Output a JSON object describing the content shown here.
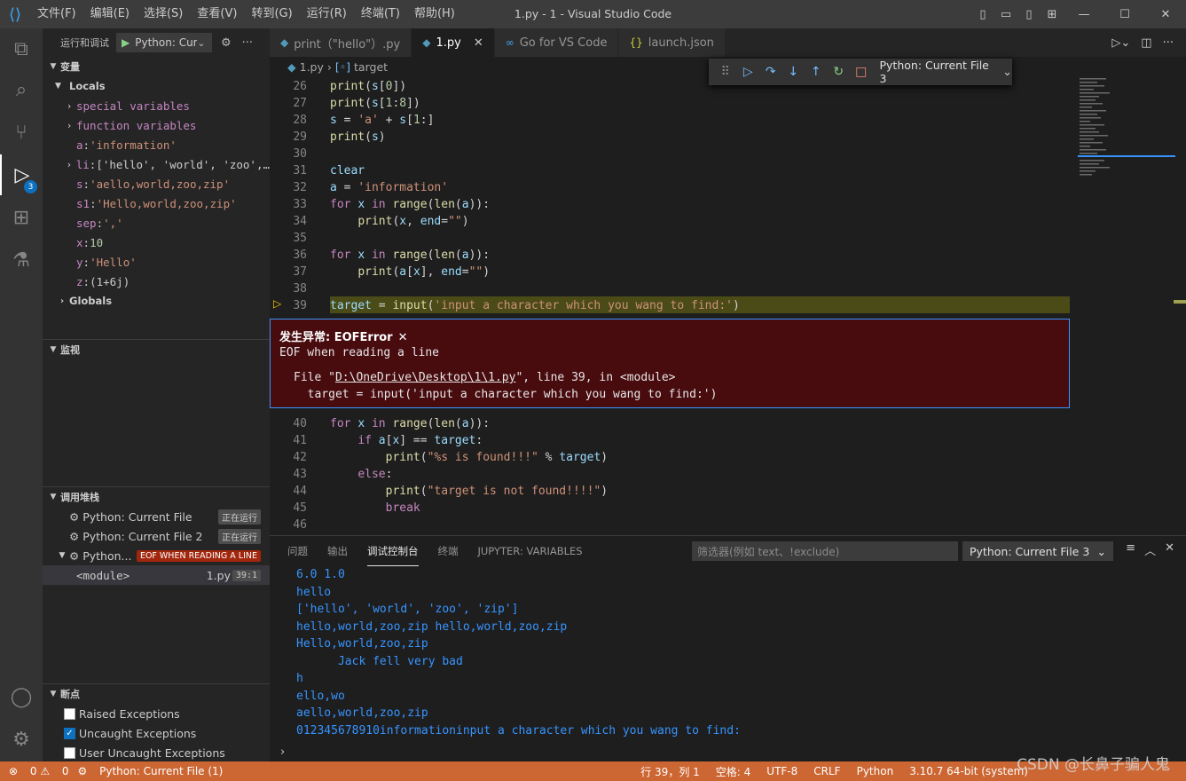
{
  "titlebar": {
    "menu": [
      "文件(F)",
      "编辑(E)",
      "选择(S)",
      "查看(V)",
      "转到(G)",
      "运行(R)",
      "终端(T)",
      "帮助(H)"
    ],
    "title": "1.py - 1 - Visual Studio Code"
  },
  "activity": {
    "debug_badge": "3"
  },
  "sidebar": {
    "header": "运行和调试",
    "run_config": "Python: Current File",
    "variables_title": "变量",
    "locals_label": "Locals",
    "locals": [
      {
        "type": "group",
        "name": "special variables"
      },
      {
        "type": "group",
        "name": "function variables"
      },
      {
        "type": "leaf",
        "name": "a",
        "value": "'information'"
      },
      {
        "type": "group",
        "name": "li",
        "value": "['hello', 'world', 'zoo',…"
      },
      {
        "type": "leaf",
        "name": "s",
        "value": "'aello,world,zoo,zip'"
      },
      {
        "type": "leaf",
        "name": "s1",
        "value": "'Hello,world,zoo,zip'"
      },
      {
        "type": "leaf",
        "name": "sep",
        "value": "','"
      },
      {
        "type": "leaf",
        "name": "x",
        "value": "10"
      },
      {
        "type": "leaf",
        "name": "y",
        "value": "'Hello'"
      },
      {
        "type": "leaf",
        "name": "z",
        "value": "(1+6j)"
      }
    ],
    "globals_label": "Globals",
    "watch_title": "监视",
    "callstack_title": "调用堆栈",
    "callstack": [
      {
        "name": "Python: Current File",
        "status": "正在运行"
      },
      {
        "name": "Python: Current File 2",
        "status": "正在运行"
      },
      {
        "name": "Python...",
        "status": "EOF WHEN READING A LINE"
      }
    ],
    "frame": {
      "name": "<module>",
      "file": "1.py",
      "pos": "39:1"
    },
    "breakpoints_title": "断点",
    "breakpoints": [
      {
        "label": "Raised Exceptions",
        "checked": false
      },
      {
        "label": "Uncaught Exceptions",
        "checked": true
      },
      {
        "label": "User Uncaught Exceptions",
        "checked": false
      }
    ]
  },
  "tabs": [
    {
      "label": "print（\"hello\"）.py",
      "active": false
    },
    {
      "label": "1.py",
      "active": true
    },
    {
      "label": "Go for VS Code",
      "active": false
    },
    {
      "label": "launch.json",
      "active": false
    }
  ],
  "breadcrumb": {
    "file": "1.py",
    "symbol": "target"
  },
  "debug_toolbar": {
    "config": "Python: Current File 3"
  },
  "exception": {
    "title": "发生异常: EOFError",
    "message": "EOF when reading a line",
    "trace_prefix": "File \"",
    "trace_path": "D:\\OneDrive\\Desktop\\1\\1.py",
    "trace_suffix": "\", line 39, in <module>",
    "trace_line2": "  target = input('input a character which you wang to find:')"
  },
  "panel": {
    "tabs": [
      "问题",
      "输出",
      "调试控制台",
      "终端",
      "JUPYTER: VARIABLES"
    ],
    "active_tab": "调试控制台",
    "filter_placeholder": "筛选器(例如 text、!exclude)",
    "config": "Python: Current File 3",
    "console_lines": [
      "6.0 1.0",
      "hello",
      "['hello', 'world', 'zoo', 'zip']",
      "hello,world,zoo,zip hello,world,zoo,zip",
      "Hello,world,zoo,zip",
      "      Jack fell very bad",
      "h",
      "ello,wo",
      "aello,world,zoo,zip",
      "012345678910informationinput a character which you wang to find:"
    ]
  },
  "status": {
    "errors": "0",
    "warnings": "0",
    "debug": "Python: Current File (1)",
    "position": "行 39，列 1",
    "spaces": "空格: 4",
    "encoding": "UTF-8",
    "eol": "CRLF",
    "language": "Python",
    "interpreter": "3.10.7 64-bit (system)"
  },
  "watermark": "CSDN @长鼻子骗人鬼",
  "colors": {
    "status_bar": "#cc6633",
    "exception_bg": "#480b0e",
    "current_line": "#4b4b18",
    "accent": "#3794ff"
  }
}
